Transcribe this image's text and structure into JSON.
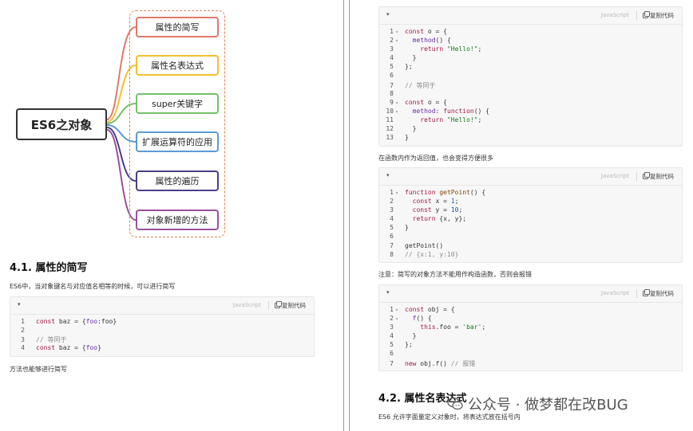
{
  "mindmap": {
    "center": "ES6之对象",
    "branches": [
      {
        "label": "属性的简写",
        "color": "#e07a6b"
      },
      {
        "label": "属性名表达式",
        "color": "#f2c12e"
      },
      {
        "label": "super关键字",
        "color": "#74c06a"
      },
      {
        "label": "扩展运算符的应用",
        "color": "#5b9bd5"
      },
      {
        "label": "属性的遍历",
        "color": "#4a3f8a"
      },
      {
        "label": "对象新增的方法",
        "color": "#9c4f9c"
      }
    ],
    "frame_color": "#e8824e"
  },
  "code_ui": {
    "lang": "JavaScript",
    "copy_label": "复制代码",
    "toggle": "▾"
  },
  "left": {
    "section_title": "4.1. 属性的简写",
    "intro": "ES6中，当对象键名与对应值名相等的时候，可以进行简写",
    "after": "方法也能够进行简写",
    "code": [
      {
        "n": "1",
        "tokens": [
          {
            "t": "kw",
            "v": "const "
          },
          {
            "t": "txt",
            "v": "baz = {"
          },
          {
            "t": "pr",
            "v": "foo"
          },
          {
            "t": "txt",
            "v": ":foo}"
          }
        ]
      },
      {
        "n": "2",
        "tokens": []
      },
      {
        "n": "3",
        "tokens": [
          {
            "t": "cm",
            "v": "// 等同于"
          }
        ]
      },
      {
        "n": "4",
        "tokens": [
          {
            "t": "kw",
            "v": "const "
          },
          {
            "t": "txt",
            "v": "baz = {"
          },
          {
            "t": "pr",
            "v": "foo"
          },
          {
            "t": "txt",
            "v": "}"
          }
        ]
      }
    ]
  },
  "right": {
    "code1": [
      {
        "n": "1",
        "f": "▾",
        "tokens": [
          {
            "t": "kw",
            "v": "const "
          },
          {
            "t": "txt",
            "v": "o = {"
          }
        ]
      },
      {
        "n": "2",
        "f": "▾",
        "tokens": [
          {
            "t": "txt",
            "v": "  "
          },
          {
            "t": "pr",
            "v": "method"
          },
          {
            "t": "txt",
            "v": "() {"
          }
        ]
      },
      {
        "n": "3",
        "tokens": [
          {
            "t": "txt",
            "v": "    "
          },
          {
            "t": "kw",
            "v": "return "
          },
          {
            "t": "str",
            "v": "\"Hello!\""
          },
          {
            "t": "txt",
            "v": ";"
          }
        ]
      },
      {
        "n": "4",
        "tokens": [
          {
            "t": "txt",
            "v": "  }"
          }
        ]
      },
      {
        "n": "5",
        "tokens": [
          {
            "t": "txt",
            "v": "};"
          }
        ]
      },
      {
        "n": "6",
        "tokens": []
      },
      {
        "n": "7",
        "tokens": [
          {
            "t": "cm",
            "v": "// 等同于"
          }
        ]
      },
      {
        "n": "8",
        "tokens": []
      },
      {
        "n": "9",
        "f": "▾",
        "tokens": [
          {
            "t": "kw",
            "v": "const "
          },
          {
            "t": "txt",
            "v": "o = {"
          }
        ]
      },
      {
        "n": "10",
        "f": "▾",
        "tokens": [
          {
            "t": "txt",
            "v": "  "
          },
          {
            "t": "pr",
            "v": "method"
          },
          {
            "t": "txt",
            "v": ": "
          },
          {
            "t": "kw",
            "v": "function"
          },
          {
            "t": "txt",
            "v": "() {"
          }
        ]
      },
      {
        "n": "11",
        "tokens": [
          {
            "t": "txt",
            "v": "    "
          },
          {
            "t": "kw",
            "v": "return "
          },
          {
            "t": "str",
            "v": "\"Hello!\""
          },
          {
            "t": "txt",
            "v": ";"
          }
        ]
      },
      {
        "n": "12",
        "tokens": [
          {
            "t": "txt",
            "v": "  }"
          }
        ]
      },
      {
        "n": "13",
        "tokens": [
          {
            "t": "txt",
            "v": "}"
          }
        ]
      }
    ],
    "text1": "在函数内作为返回值，也会变得方便很多",
    "code2": [
      {
        "n": "1",
        "f": "▾",
        "tokens": [
          {
            "t": "kw",
            "v": "function "
          },
          {
            "t": "fn",
            "v": "getPoint"
          },
          {
            "t": "txt",
            "v": "() {"
          }
        ]
      },
      {
        "n": "2",
        "tokens": [
          {
            "t": "txt",
            "v": "  "
          },
          {
            "t": "kw",
            "v": "const "
          },
          {
            "t": "txt",
            "v": "x = "
          },
          {
            "t": "num",
            "v": "1"
          },
          {
            "t": "txt",
            "v": ";"
          }
        ]
      },
      {
        "n": "3",
        "tokens": [
          {
            "t": "txt",
            "v": "  "
          },
          {
            "t": "kw",
            "v": "const "
          },
          {
            "t": "txt",
            "v": "y = "
          },
          {
            "t": "num",
            "v": "10"
          },
          {
            "t": "txt",
            "v": ";"
          }
        ]
      },
      {
        "n": "4",
        "tokens": [
          {
            "t": "txt",
            "v": "  "
          },
          {
            "t": "kw",
            "v": "return "
          },
          {
            "t": "txt",
            "v": "{x, y};"
          }
        ]
      },
      {
        "n": "5",
        "tokens": [
          {
            "t": "txt",
            "v": "}"
          }
        ]
      },
      {
        "n": "6",
        "tokens": []
      },
      {
        "n": "7",
        "tokens": [
          {
            "t": "txt",
            "v": "getPoint()"
          }
        ]
      },
      {
        "n": "8",
        "tokens": [
          {
            "t": "cm",
            "v": "// {x:1, y:10}"
          }
        ]
      }
    ],
    "text2": "注意：简写的对象方法不能用作构造函数，否则会报错",
    "code3": [
      {
        "n": "1",
        "f": "▾",
        "tokens": [
          {
            "t": "kw",
            "v": "const "
          },
          {
            "t": "txt",
            "v": "obj = {"
          }
        ]
      },
      {
        "n": "2",
        "f": "▾",
        "tokens": [
          {
            "t": "txt",
            "v": "  "
          },
          {
            "t": "pr",
            "v": "f"
          },
          {
            "t": "txt",
            "v": "() {"
          }
        ]
      },
      {
        "n": "3",
        "tokens": [
          {
            "t": "txt",
            "v": "    "
          },
          {
            "t": "kw",
            "v": "this"
          },
          {
            "t": "txt",
            "v": ".foo = "
          },
          {
            "t": "str",
            "v": "'bar'"
          },
          {
            "t": "txt",
            "v": ";"
          }
        ]
      },
      {
        "n": "4",
        "tokens": [
          {
            "t": "txt",
            "v": "  }"
          }
        ]
      },
      {
        "n": "5",
        "tokens": [
          {
            "t": "txt",
            "v": "};"
          }
        ]
      },
      {
        "n": "6",
        "tokens": []
      },
      {
        "n": "7",
        "tokens": [
          {
            "t": "kw",
            "v": "new "
          },
          {
            "t": "txt",
            "v": "obj.f() "
          },
          {
            "t": "cm",
            "v": "// 报错"
          }
        ]
      }
    ],
    "section_title": "4.2. 属性名表达式",
    "intro": "ES6 允许字面量定义对象时，将表达式放在括号内"
  },
  "watermark": "公众号 · 做梦都在改BUG"
}
